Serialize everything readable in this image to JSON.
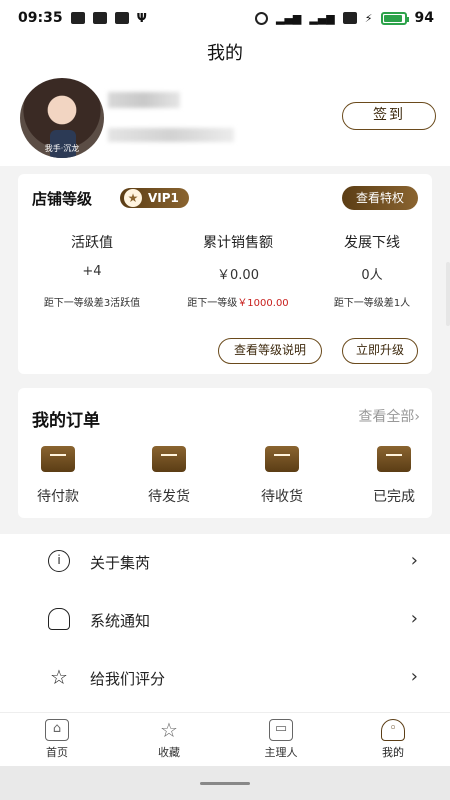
{
  "status_bar": {
    "time": "09:35",
    "battery": "94",
    "battery_level": 0.94
  },
  "header": {
    "title": "我的"
  },
  "profile": {
    "avatar_caption": "我手·沉龙",
    "signin_label": "签到"
  },
  "shop_level": {
    "title": "店铺等级",
    "vip_label": "VIP1",
    "privilege_button": "查看特权",
    "stats": [
      {
        "label": "活跃值",
        "value": "+4",
        "note_prefix": "距下一等级差",
        "note_highlight": "",
        "note_suffix": "3活跃值"
      },
      {
        "label": "累计销售额",
        "value": "￥0.00",
        "note_prefix": "距下一等级",
        "note_highlight": "￥1000.00",
        "note_suffix": ""
      },
      {
        "label": "发展下线",
        "value": "0人",
        "note_prefix": "距下一等级差",
        "note_highlight": "",
        "note_suffix": "1人"
      }
    ],
    "explain_button": "查看等级说明",
    "upgrade_button": "立即升级"
  },
  "orders": {
    "title": "我的订单",
    "view_all": "查看全部",
    "items": [
      {
        "label": "待付款",
        "icon": "wallet-icon"
      },
      {
        "label": "待发货",
        "icon": "package-icon"
      },
      {
        "label": "待收货",
        "icon": "delivery-box-icon"
      },
      {
        "label": "已完成",
        "icon": "completed-box-icon"
      }
    ]
  },
  "menu": [
    {
      "label": "关于集芮",
      "icon": "info-icon"
    },
    {
      "label": "系统通知",
      "icon": "bell-icon"
    },
    {
      "label": "给我们评分",
      "icon": "star-icon"
    }
  ],
  "tabs": [
    {
      "label": "首页",
      "icon": "home-icon"
    },
    {
      "label": "收藏",
      "icon": "star-icon"
    },
    {
      "label": "主理人",
      "icon": "shop-icon"
    },
    {
      "label": "我的",
      "icon": "person-icon"
    }
  ],
  "colors": {
    "brand_dark": "#5b3d15",
    "brand_light": "#8a6430",
    "highlight_red": "#c8201e"
  }
}
